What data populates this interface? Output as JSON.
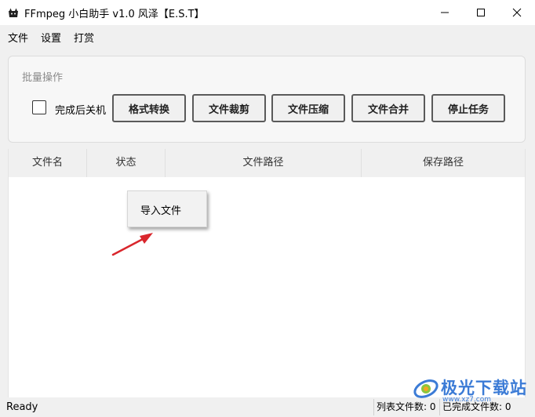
{
  "window": {
    "title": "FFmpeg 小白助手 v1.0 风泽【E.S.T】"
  },
  "menu": {
    "items": [
      "文件",
      "设置",
      "打赏"
    ]
  },
  "batch_panel": {
    "title": "批量操作",
    "shutdown_label": "完成后关机",
    "shutdown_checked": false,
    "buttons": [
      "格式转换",
      "文件裁剪",
      "文件压缩",
      "文件合并",
      "停止任务"
    ]
  },
  "table": {
    "columns": [
      "文件名",
      "状态",
      "文件路径",
      "保存路径"
    ],
    "rows": []
  },
  "context_menu": {
    "items": [
      "导入文件"
    ]
  },
  "status": {
    "text": "Ready",
    "list_count": "列表文件数: 0",
    "done_count": "已完成文件数: 0"
  },
  "watermark": {
    "text": "极光下载站",
    "sub": "www.xz7.com",
    "color": "#3b7bd6"
  },
  "colors": {
    "arrow": "#d9262c",
    "accent": "#3b7bd6"
  }
}
